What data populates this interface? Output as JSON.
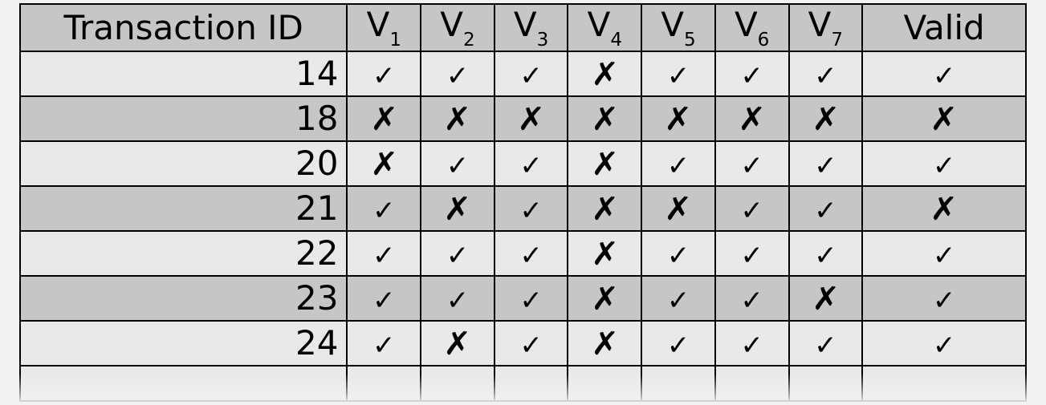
{
  "table": {
    "headers": {
      "id": "Transaction ID",
      "v_prefix": "V",
      "v_subs": [
        "1",
        "2",
        "3",
        "4",
        "5",
        "6",
        "7"
      ],
      "valid": "Valid"
    },
    "marks": {
      "check": "✓",
      "cross": "✗"
    },
    "rows": [
      {
        "id": "14",
        "v": [
          "c",
          "c",
          "c",
          "x",
          "c",
          "c",
          "c"
        ],
        "valid": "c"
      },
      {
        "id": "18",
        "v": [
          "x",
          "x",
          "x",
          "x",
          "x",
          "x",
          "x"
        ],
        "valid": "x"
      },
      {
        "id": "20",
        "v": [
          "x",
          "c",
          "c",
          "x",
          "c",
          "c",
          "c"
        ],
        "valid": "c"
      },
      {
        "id": "21",
        "v": [
          "c",
          "x",
          "c",
          "x",
          "x",
          "c",
          "c"
        ],
        "valid": "x"
      },
      {
        "id": "22",
        "v": [
          "c",
          "c",
          "c",
          "x",
          "c",
          "c",
          "c"
        ],
        "valid": "c"
      },
      {
        "id": "23",
        "v": [
          "c",
          "c",
          "c",
          "x",
          "c",
          "c",
          "x"
        ],
        "valid": "c"
      },
      {
        "id": "24",
        "v": [
          "c",
          "x",
          "c",
          "x",
          "c",
          "c",
          "c"
        ],
        "valid": "c"
      }
    ]
  }
}
